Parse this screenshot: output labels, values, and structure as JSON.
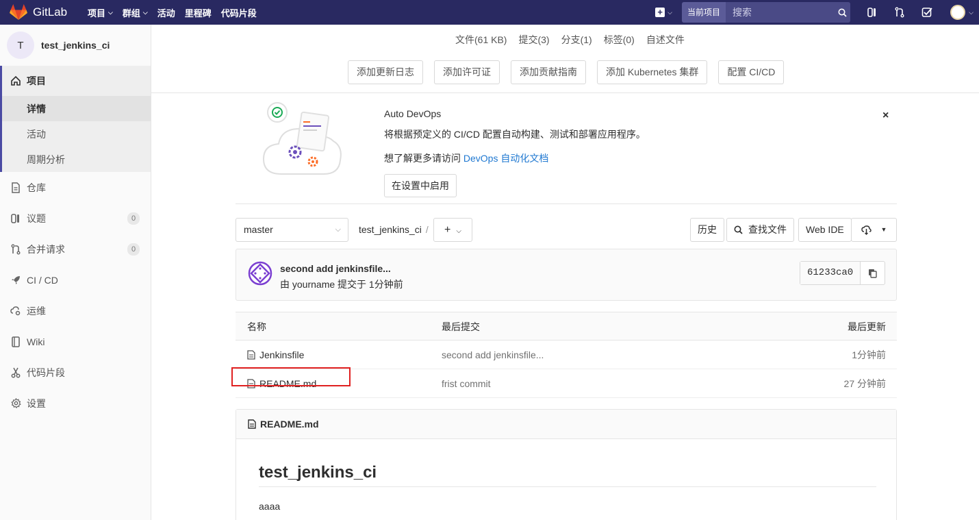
{
  "navbar": {
    "brand": "GitLab",
    "links": [
      {
        "label": "项目",
        "dropdown": true
      },
      {
        "label": "群组",
        "dropdown": true
      },
      {
        "label": "活动",
        "dropdown": false
      },
      {
        "label": "里程碑",
        "dropdown": false
      },
      {
        "label": "代码片段",
        "dropdown": false
      }
    ],
    "search_scope": "当前项目",
    "search_placeholder": "搜索",
    "icons": [
      "plus-icon",
      "issues-icon",
      "merge-request-icon",
      "todo-icon",
      "avatar"
    ]
  },
  "sidebar": {
    "project_initial": "T",
    "project_name": "test_jenkins_ci",
    "project_section": {
      "label": "项目",
      "subitems": [
        {
          "label": "详情",
          "active": true
        },
        {
          "label": "活动",
          "active": false
        },
        {
          "label": "周期分析",
          "active": false
        }
      ]
    },
    "items": [
      {
        "label": "仓库",
        "icon": "repository-icon"
      },
      {
        "label": "议题",
        "icon": "issues-icon",
        "badge": "0"
      },
      {
        "label": "合并请求",
        "icon": "merge-request-icon",
        "badge": "0"
      },
      {
        "label": "CI / CD",
        "icon": "rocket-icon"
      },
      {
        "label": "运维",
        "icon": "operations-icon"
      },
      {
        "label": "Wiki",
        "icon": "book-icon"
      },
      {
        "label": "代码片段",
        "icon": "scissors-icon"
      },
      {
        "label": "设置",
        "icon": "gear-icon"
      }
    ]
  },
  "stats": [
    "文件(61 KB)",
    "提交(3)",
    "分支(1)",
    "标签(0)",
    "自述文件"
  ],
  "quick_actions": [
    "添加更新日志",
    "添加许可证",
    "添加贡献指南",
    "添加 Kubernetes 集群",
    "配置 CI/CD"
  ],
  "devops": {
    "title": "Auto DevOps",
    "text": "将根据预定义的 CI/CD 配置自动构建、测试和部署应用程序。",
    "link_prefix": "想了解更多请访问 ",
    "link_text": "DevOps 自动化文档",
    "button": "在设置中启用",
    "close": "×"
  },
  "repo": {
    "branch": "master",
    "path": "test_jenkins_ci",
    "path_sep": "/",
    "add": "+",
    "history": "历史",
    "find_file": "查找文件",
    "web_ide": "Web IDE"
  },
  "last_commit": {
    "title": "second add jenkinsfile...",
    "meta": "由 yourname 提交于 1分钟前",
    "sha": "61233ca0"
  },
  "files": {
    "headers": {
      "name": "名称",
      "last_commit": "最后提交",
      "last_update": "最后更新"
    },
    "rows": [
      {
        "name": "Jenkinsfile",
        "commit": "second add jenkinsfile...",
        "updated": "1分钟前"
      },
      {
        "name": "README.md",
        "commit": "frist commit",
        "updated": "27 分钟前"
      }
    ]
  },
  "readme": {
    "filename": "README.md",
    "heading": "test_jenkins_ci",
    "body": "aaaa"
  },
  "colors": {
    "navbar": "#292961",
    "sidebar_active_border": "#4b4ba3",
    "link": "#1f78d1",
    "highlight_box": "#e02020"
  }
}
